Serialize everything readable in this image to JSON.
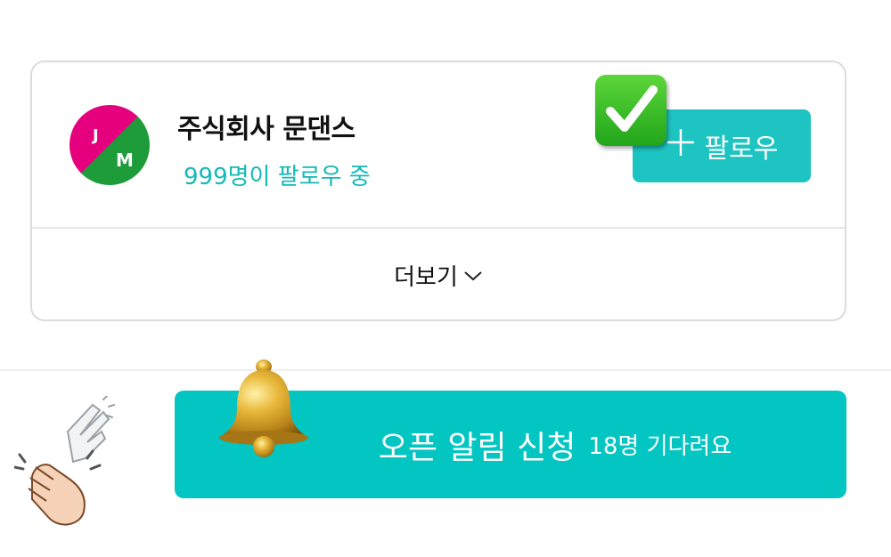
{
  "company": {
    "logo_initials": [
      "J",
      "M"
    ],
    "name": "주식회사 문댄스",
    "followers_text": "999명이 팔로우 중"
  },
  "follow_button": {
    "icon": "plus-icon",
    "label": "팔로우"
  },
  "more": {
    "label": "더보기",
    "icon": "chevron-down-icon"
  },
  "open_notification": {
    "label": "오픈 알림 신청",
    "waiting_text": "18명 기다려요",
    "icon": "bell-icon"
  },
  "decorations": {
    "check_icon": "check-mark-icon",
    "clap_icon": "clapping-hands-icon"
  },
  "colors": {
    "accent": "#1ec4c1",
    "accent_text": "#13b9b6",
    "logo_pink": "#e5007e",
    "logo_green": "#1f9c3a"
  }
}
